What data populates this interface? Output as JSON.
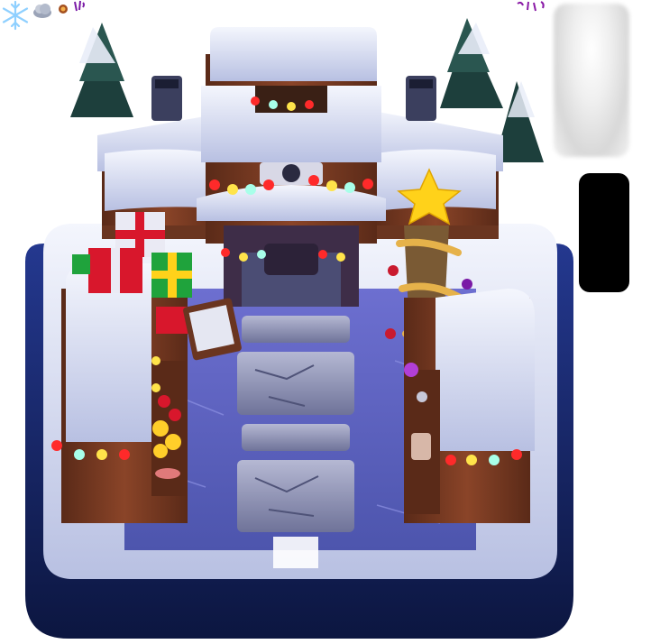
{
  "sprite_sheet": {
    "main_scene": "winter-village-arena",
    "icons": [
      "snowflake-icon",
      "cloud-icon",
      "gem-icon",
      "glyph-icon"
    ],
    "colors": {
      "base_dark": "#0f1d4c",
      "base_mid": "#1d2e78",
      "snow": "#e9edf8",
      "snow_shadow": "#a7b0d6",
      "wood": "#7a3a22",
      "wood_dark": "#4f2415",
      "stone": "#7f82a6",
      "floor": "#5f62b8",
      "light_red": "#ff2a2a",
      "light_yellow": "#ffe44a",
      "light_cyan": "#a8ffe9",
      "gift_red": "#d8172c",
      "gift_green": "#1fa33c",
      "star_gold": "#ffd21a"
    }
  }
}
